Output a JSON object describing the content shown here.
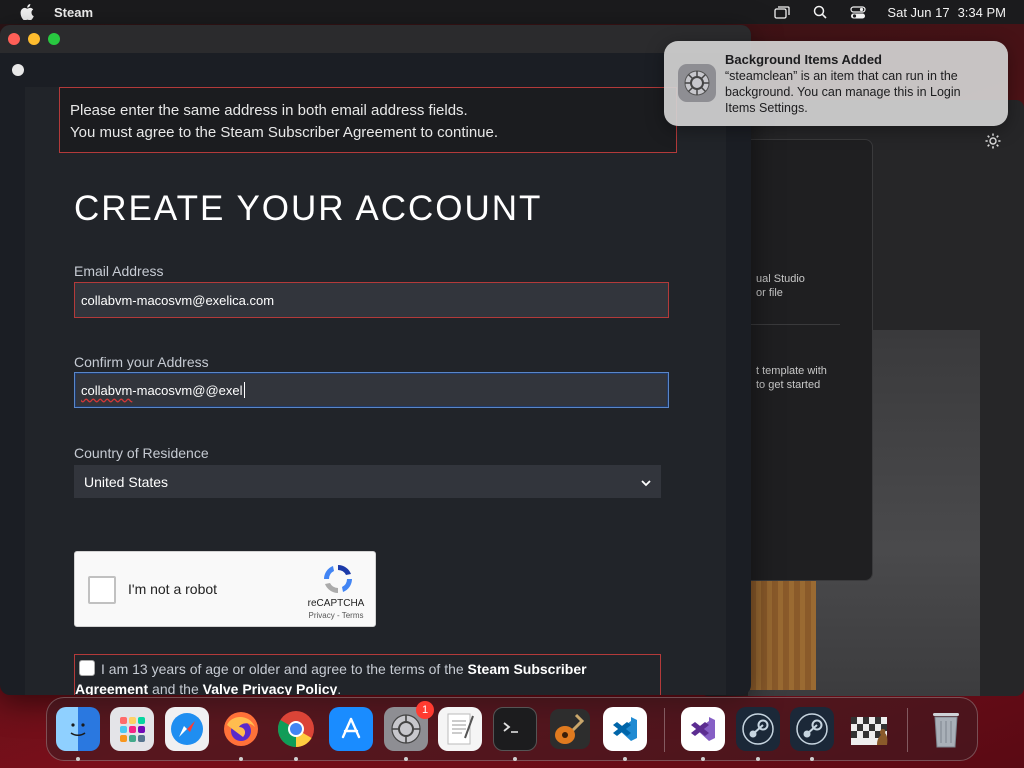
{
  "menubar": {
    "app_name": "Steam",
    "date": "Sat Jun 17",
    "time": "3:34 PM"
  },
  "background_window": {
    "text1": "ual Studio\nor file",
    "text2": "t template with\nto get started"
  },
  "notification": {
    "title": "Background Items Added",
    "body": "“steamclean” is an item that can run in the background. You can manage this in Login Items Settings."
  },
  "form": {
    "errors": [
      "Please enter the same address in both email address fields.",
      "You must agree to the Steam Subscriber Agreement to continue."
    ],
    "heading": "CREATE YOUR ACCOUNT",
    "email_label": "Email Address",
    "email_value": "collabvm-macosvm@exelica.com",
    "confirm_label": "Confirm your Address",
    "confirm_value_prefix": "collabvm",
    "confirm_value_suffix": "-macosvm@@exel",
    "country_label": "Country of Residence",
    "country_value": "United States",
    "captcha_label": "I'm not a robot",
    "captcha_brand": "reCAPTCHA",
    "captcha_links": "Privacy - Terms",
    "agree_prefix": "I am 13 years of age or older and agree to the terms of the",
    "agree_link1": "Steam Subscriber Agreement",
    "agree_mid": "and the",
    "agree_link2": "Valve Privacy Policy",
    "agree_suffix": "."
  },
  "dock": {
    "items": [
      "Finder",
      "Launchpad",
      "Safari",
      "Firefox",
      "Chrome",
      "App Store",
      "System Settings",
      "TextEdit",
      "Terminal",
      "GarageBand",
      "VS Code",
      "Visual Studio",
      "Steam",
      "Steam",
      "Chess",
      "Trash"
    ],
    "system_settings_badge": "1"
  },
  "colors": {
    "error_border": "#b33a3a",
    "focus_border": "#5a86c7",
    "field_bg": "#32353c",
    "content_bg": "#212429"
  }
}
